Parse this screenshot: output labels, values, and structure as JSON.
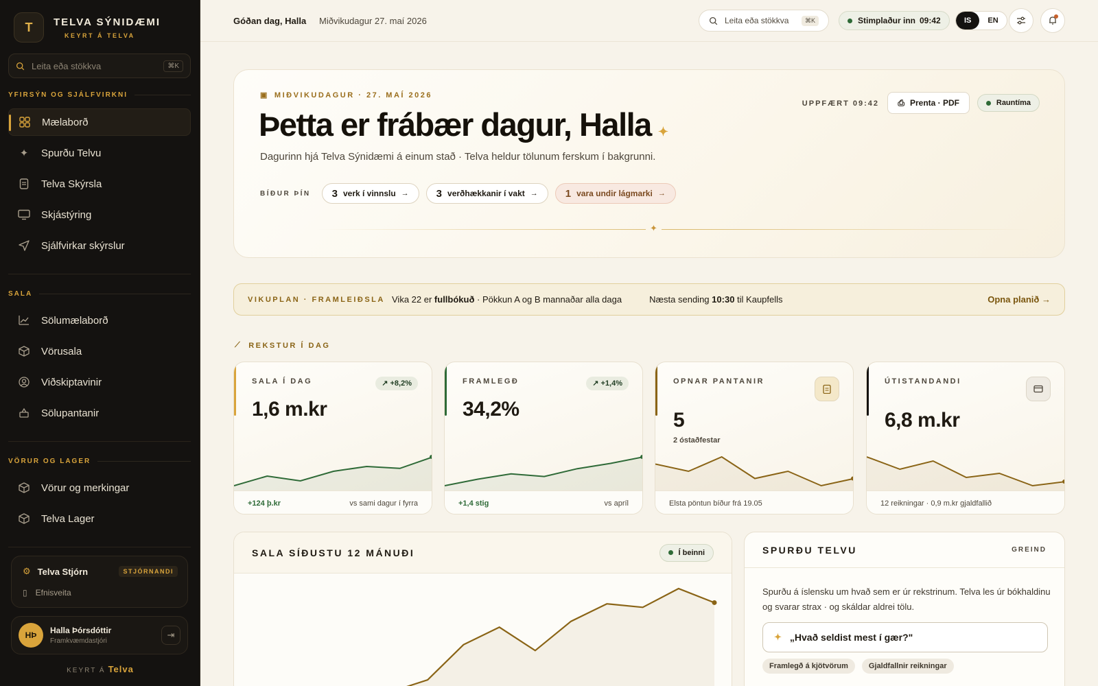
{
  "brand": {
    "logo_letter": "T",
    "name": "TELVA SÝNIDÆMI",
    "sub": "KEYRT Á TELVA"
  },
  "sidebar": {
    "search_placeholder": "Leita eða stökkva",
    "search_kbd": "⌘K",
    "sections": [
      {
        "title": "YFIRSÝN OG SJÁLFVIRKNI",
        "items": [
          {
            "label": "Mælaborð",
            "icon": "grid-icon",
            "active": true
          },
          {
            "label": "Spurðu Telvu",
            "icon": "sparkle-icon"
          },
          {
            "label": "Telva Skýrsla",
            "icon": "document-icon"
          },
          {
            "label": "Skjástýring",
            "icon": "monitor-icon"
          },
          {
            "label": "Sjálfvirkar skýrslur",
            "icon": "send-icon"
          }
        ]
      },
      {
        "title": "SALA",
        "items": [
          {
            "label": "Sölumælaborð",
            "icon": "chart-line-icon"
          },
          {
            "label": "Vörusala",
            "icon": "box-icon"
          },
          {
            "label": "Viðskiptavinir",
            "icon": "user-circle-icon"
          },
          {
            "label": "Sölupantanir",
            "icon": "basket-icon"
          }
        ]
      },
      {
        "title": "VÖRUR OG LAGER",
        "items": [
          {
            "label": "Vörur og merkingar",
            "icon": "box-icon"
          },
          {
            "label": "Telva Lager",
            "icon": "box-icon"
          }
        ]
      }
    ],
    "admin": {
      "title": "Telva Stjórn",
      "badge": "STJÓRNANDI",
      "sub": "Efnisveita"
    },
    "user": {
      "initials": "HÞ",
      "name": "Halla Þórsdóttir",
      "role": "Framkvæmdastjóri"
    },
    "footer": {
      "prefix": "KEYRT Á",
      "brand": "Telva"
    }
  },
  "topbar": {
    "greeting": "Góðan dag, Halla",
    "date": "Miðvikudagur 27. maí 2026",
    "search_placeholder": "Leita eða stökkva",
    "search_kbd": "⌘K",
    "clock_label": "Stimplaður inn",
    "clock_time": "09:42",
    "lang_is": "IS",
    "lang_en": "EN"
  },
  "hero": {
    "date": "MIÐVIKUDAGUR · 27. MAÍ 2026",
    "title": "Þetta er frábær dagur, Halla",
    "subtitle": "Dagurinn hjá Telva Sýnidæmi á einum stað · Telva heldur tölunum ferskum í bakgrunni.",
    "waiting_label": "BÍÐUR ÞÍN",
    "chips": [
      {
        "n": "3",
        "label": "verk í vinnslu"
      },
      {
        "n": "3",
        "label": "verðhækkanir í vakt"
      },
      {
        "n": "1",
        "label": "vara undir lágmarki"
      }
    ],
    "updated": "UPPFÆRT 09:42",
    "print_label": "Prenta · PDF",
    "live_label": "Rauntíma"
  },
  "plan": {
    "label": "VIKUPLAN · FRAMLEIÐSLA",
    "text_pre": "Vika 22 er",
    "text_bold": "fullbókuð",
    "text_post": "· Pökkun A og B mannaðar alla daga",
    "next_pre": "Næsta sending",
    "next_time": "10:30",
    "next_post": "til Kaupfells",
    "link": "Opna planið"
  },
  "section_title": "REKSTUR Í DAG",
  "kpis": [
    {
      "label": "SALA Í DAG",
      "value": "1,6 m.kr",
      "trend": "+8,2%",
      "foot_left": "+124 þ.kr",
      "foot_right": "vs sami dagur í fyrra",
      "series": [
        2,
        4,
        3,
        5,
        6,
        5.6,
        8
      ],
      "color": "#2e6a37"
    },
    {
      "label": "FRAMLEGÐ",
      "value": "34,2%",
      "trend": "+1,4%",
      "foot_left": "+1,4 stig",
      "foot_right": "vs apríl",
      "series": [
        2,
        3,
        3.8,
        3.4,
        4.6,
        5.4,
        6.4
      ],
      "color": "#2e6a37"
    },
    {
      "label": "OPNAR PANTANIR",
      "value": "5",
      "sub": "2 óstaðfestar",
      "icon": "clipboard-icon",
      "foot_left": "Elsta pöntun bíður frá 19.05",
      "series": [
        6,
        5,
        7,
        4,
        5,
        3,
        4
      ],
      "color": "#8a6416"
    },
    {
      "label": "ÚTISTANDANDI",
      "value": "6,8 m.kr",
      "icon": "card-icon",
      "foot_left": "12 reikningar · 0,9 m.kr gjaldfallið",
      "series": [
        7,
        5.5,
        6.5,
        4.5,
        5,
        3.5,
        4
      ],
      "color": "#8a6416"
    }
  ],
  "chart": {
    "title": "SALA SÍÐUSTU 12 MÁNUÐI",
    "live_label": "Í beinni",
    "values": [
      0,
      1,
      4,
      5.5,
      3.5,
      6,
      7.5,
      7.2,
      8.8,
      7.6
    ]
  },
  "ask": {
    "title": "SPURÐU TELVU",
    "tag": "GREIND",
    "body": "Spurðu á íslensku um hvað sem er úr rekstrinum. Telva les úr bókhaldinu og svarar strax · og skáldar aldrei tölu.",
    "prompt": "„Hvað seldist mest í gær?\"",
    "suggestions": [
      "Framlegð á kjötvörum",
      "Gjaldfallnir reikningar"
    ]
  }
}
